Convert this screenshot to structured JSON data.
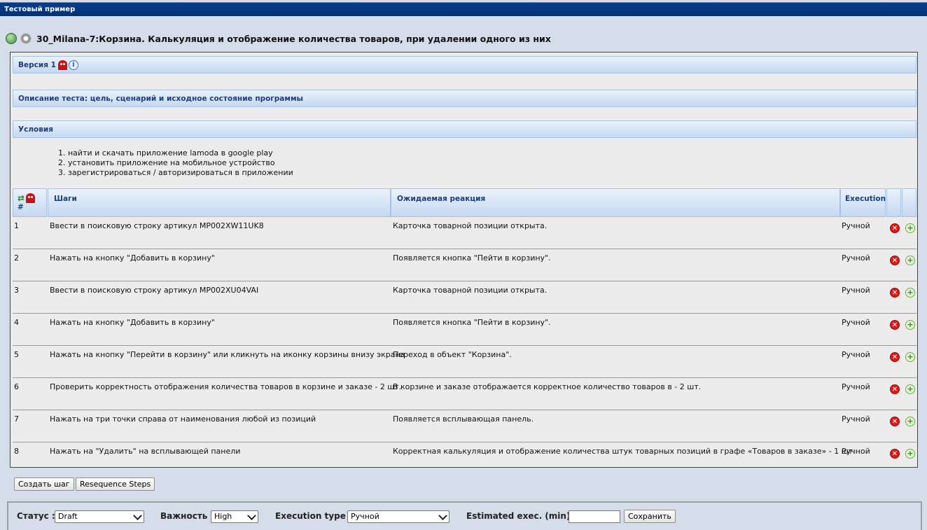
{
  "window_title": "Тестовый пример",
  "page_title": "30_Milana-7:Корзина. Калькуляция и отображение количества товаров, при удалении одного из них",
  "sections": {
    "version": "Версия 1",
    "description": "Описание теста: цель, сценарий и исходное состояние программы",
    "conditions": "Условия"
  },
  "conditions_list": [
    "1. найти и скачать приложение lamoda  в google play",
    "2. установить приложение на мобильное устройство",
    "3. зарегистрироваться / авторизироваться в приложении"
  ],
  "table": {
    "headers": {
      "num": "#",
      "steps": "Шаги",
      "expected": "Ожидаемая реакция",
      "execution": "Execution"
    },
    "rows": [
      {
        "num": "1",
        "step": "Ввести в поисковую строку артикул MP002XW11UK8",
        "expected": "Карточка товарной позиции открыта.",
        "exec": "Ручной"
      },
      {
        "num": "2",
        "step": "Нажать на кнопку \"Добавить в корзину\"",
        "expected": "Появляется кнопка \"Пейти в корзину\".",
        "exec": "Ручной"
      },
      {
        "num": "3",
        "step": "Ввести в поисковую строку артикул MP002XU04VAI",
        "expected": "Карточка товарной позиции открыта.",
        "exec": "Ручной"
      },
      {
        "num": "4",
        "step": "Нажать на кнопку \"Добавить в корзину\"",
        "expected": "Появляется кнопка \"Пейти в корзину\".",
        "exec": "Ручной"
      },
      {
        "num": "5",
        "step": "Нажать на кнопку \"Перейти в корзину\" или кликнуть на иконку корзины внизу экрана",
        "expected": "Переход в объект \"Корзина\".",
        "exec": "Ручной"
      },
      {
        "num": "6",
        "step": "Проверить корректность отображения количества товаров в корзине и заказе - 2 шт.",
        "expected": "В корзине  и заказе отображается корректное количество товаров в - 2 шт.",
        "exec": "Ручной"
      },
      {
        "num": "7",
        "step": "Нажать на три точки справа от наименования любой из позиций",
        "expected": "Появляется всплывающая панель.",
        "exec": "Ручной"
      },
      {
        "num": "8",
        "step": "Нажать на \"Удалить\" на всплывающей панели",
        "expected": "Корректная калькуляция и отображение количества штук товарных позиций в графе «Товаров в заказе» - 1 шт.",
        "exec": "Ручной"
      }
    ]
  },
  "buttons": {
    "create_step": "Создать шаг",
    "resequence": "Resequence Steps",
    "save": "Сохранить"
  },
  "form": {
    "status_label": "Статус :",
    "status_value": "Draft",
    "importance_label": "Важность :",
    "importance_value": "High",
    "exec_type_label": "Execution type :",
    "exec_type_value": "Ручной",
    "estimated_label": "Estimated exec. (min) :",
    "estimated_value": ""
  },
  "icons": {
    "delete": "delete-icon",
    "add": "add-icon",
    "ghost": "ghost-icon",
    "info": "info-icon",
    "gear": "gear-icon",
    "home": "home-icon",
    "reorder": "reorder-icon"
  },
  "colors": {
    "title_bar": "#043172",
    "section_text": "#1d3f78",
    "delete": "#d81c1c",
    "add": "#6aae48"
  }
}
